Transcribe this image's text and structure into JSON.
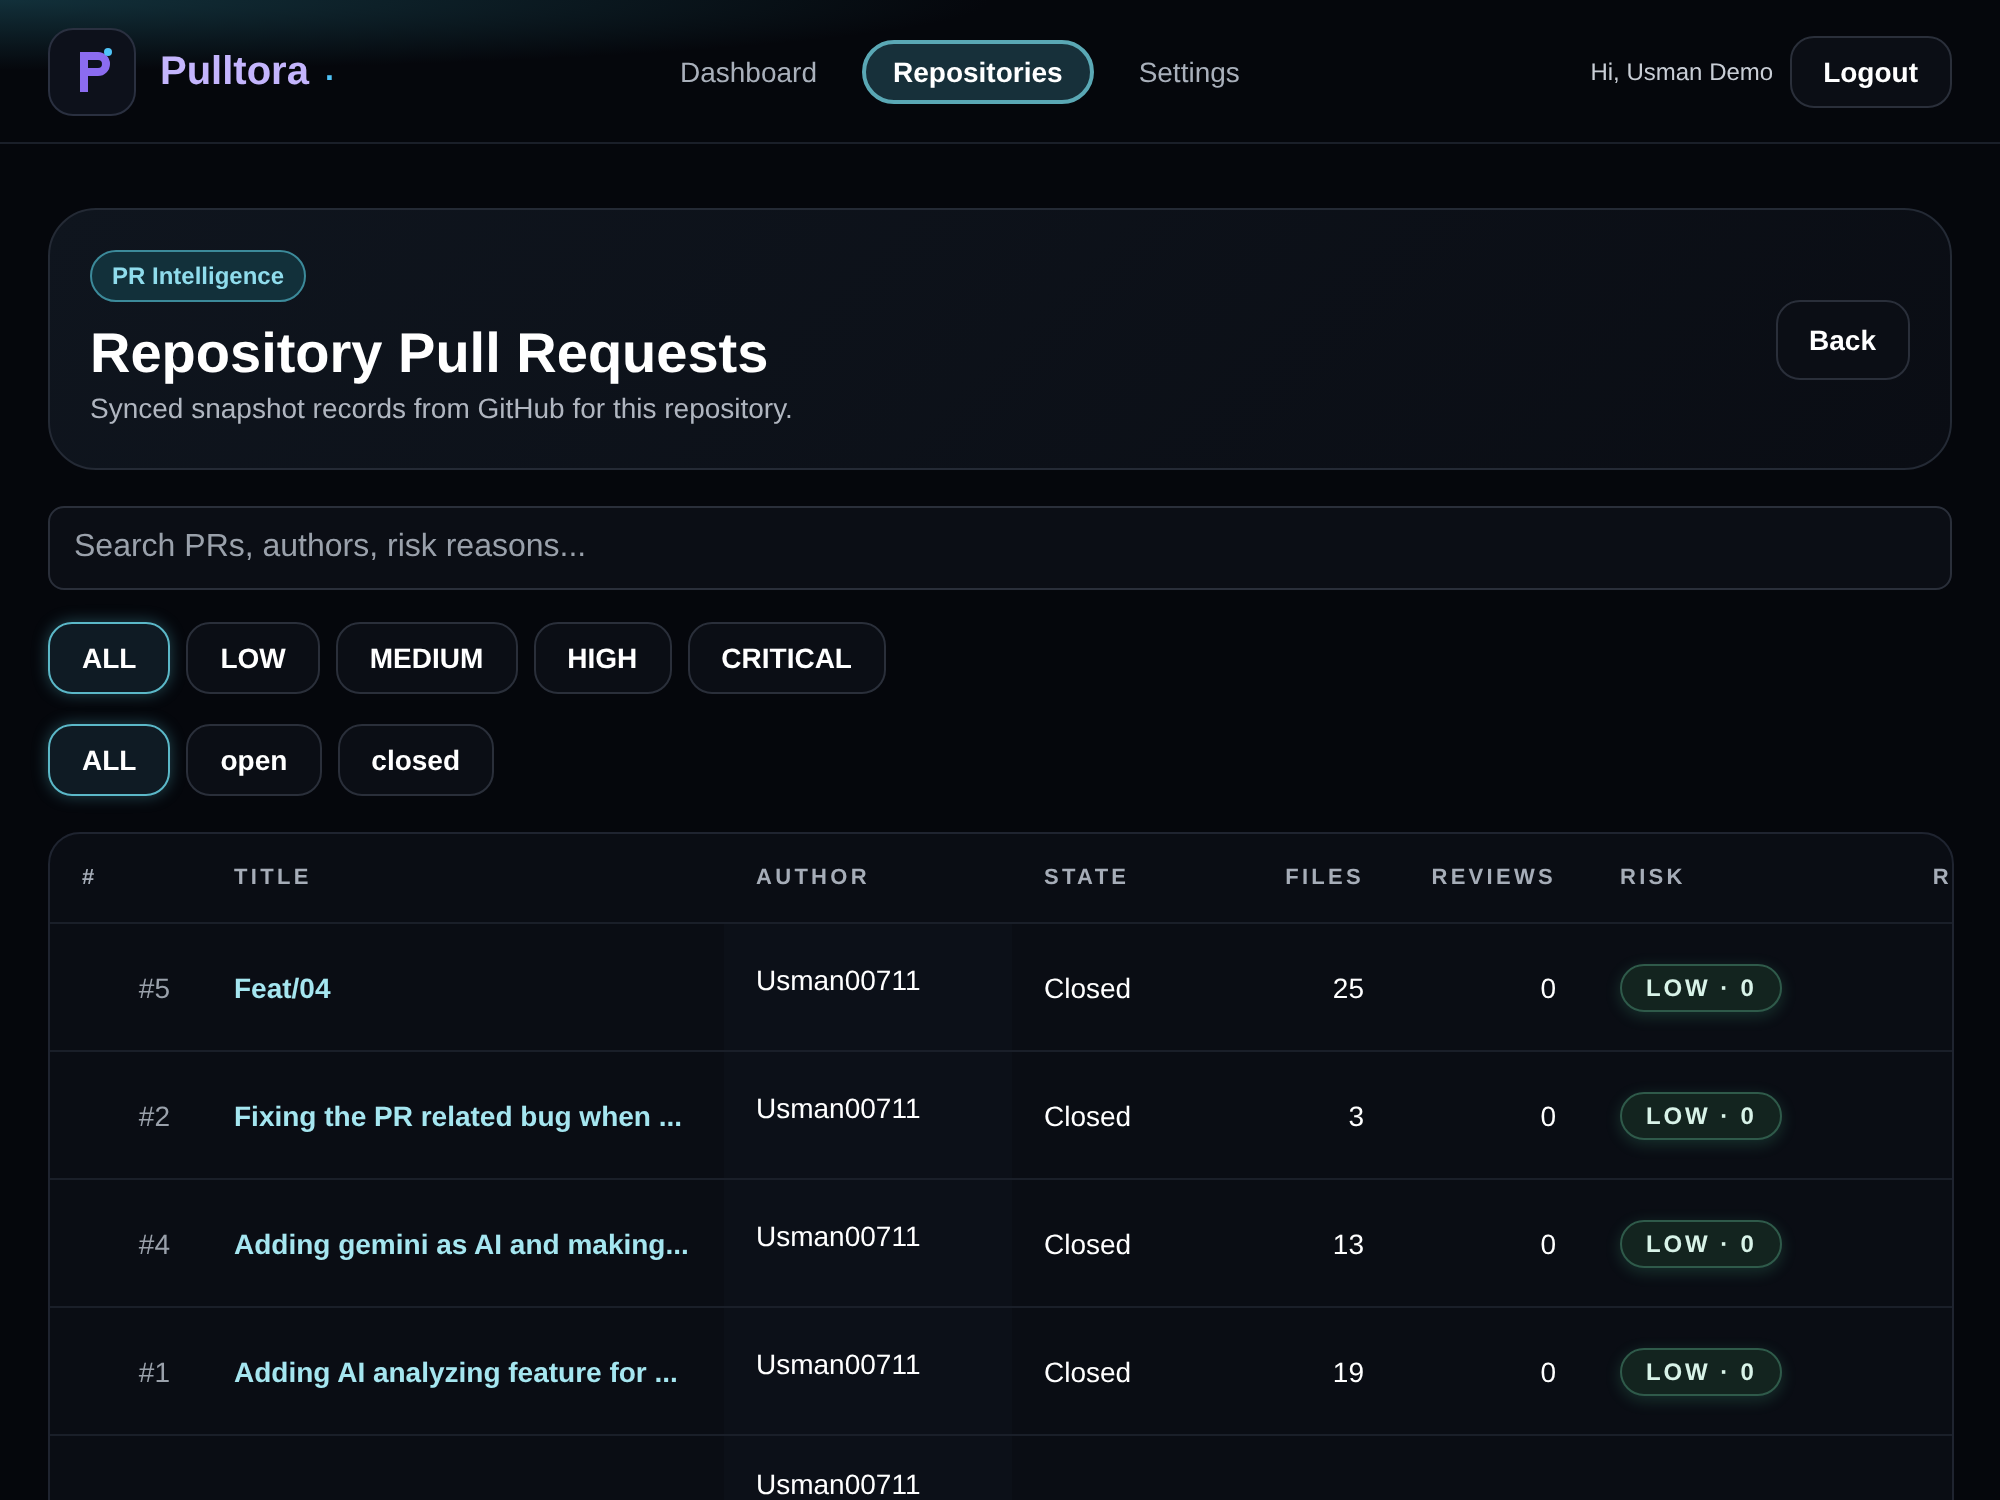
{
  "brand": {
    "name": "Pulltora",
    "dot": "."
  },
  "nav": [
    {
      "label": "Dashboard",
      "selected": false
    },
    {
      "label": "Repositories",
      "selected": true
    },
    {
      "label": "Settings",
      "selected": false
    }
  ],
  "user": {
    "greeting": "Hi, Usman Demo",
    "logout": "Logout"
  },
  "header": {
    "badge": "PR Intelligence",
    "title": "Repository Pull Requests",
    "subtitle": "Synced snapshot records from GitHub for this repository.",
    "back": "Back"
  },
  "search": {
    "placeholder": "Search PRs, authors, risk reasons..."
  },
  "risk_filters": [
    {
      "label": "ALL",
      "selected": true
    },
    {
      "label": "LOW",
      "selected": false
    },
    {
      "label": "MEDIUM",
      "selected": false
    },
    {
      "label": "HIGH",
      "selected": false
    },
    {
      "label": "CRITICAL",
      "selected": false
    }
  ],
  "state_filters": [
    {
      "label": "ALL",
      "selected": true
    },
    {
      "label": "open",
      "selected": false
    },
    {
      "label": "closed",
      "selected": false
    }
  ],
  "table": {
    "columns": [
      "#",
      "TITLE",
      "AUTHOR",
      "STATE",
      "FILES",
      "REVIEWS",
      "RISK",
      "R"
    ],
    "rows": [
      {
        "number": "#5",
        "title": "Feat/04",
        "author": "Usman00711",
        "state": "Closed",
        "files": "25",
        "reviews": "0",
        "risk": "LOW · 0"
      },
      {
        "number": "#2",
        "title": "Fixing the PR related bug when ...",
        "author": "Usman00711",
        "state": "Closed",
        "files": "3",
        "reviews": "0",
        "risk": "LOW · 0"
      },
      {
        "number": "#4",
        "title": "Adding gemini as AI and making...",
        "author": "Usman00711",
        "state": "Closed",
        "files": "13",
        "reviews": "0",
        "risk": "LOW · 0"
      },
      {
        "number": "#1",
        "title": "Adding AI analyzing feature for ...",
        "author": "Usman00711",
        "state": "Closed",
        "files": "19",
        "reviews": "0",
        "risk": "LOW · 0"
      }
    ],
    "partial_row": {
      "author": "Usman00711"
    }
  }
}
